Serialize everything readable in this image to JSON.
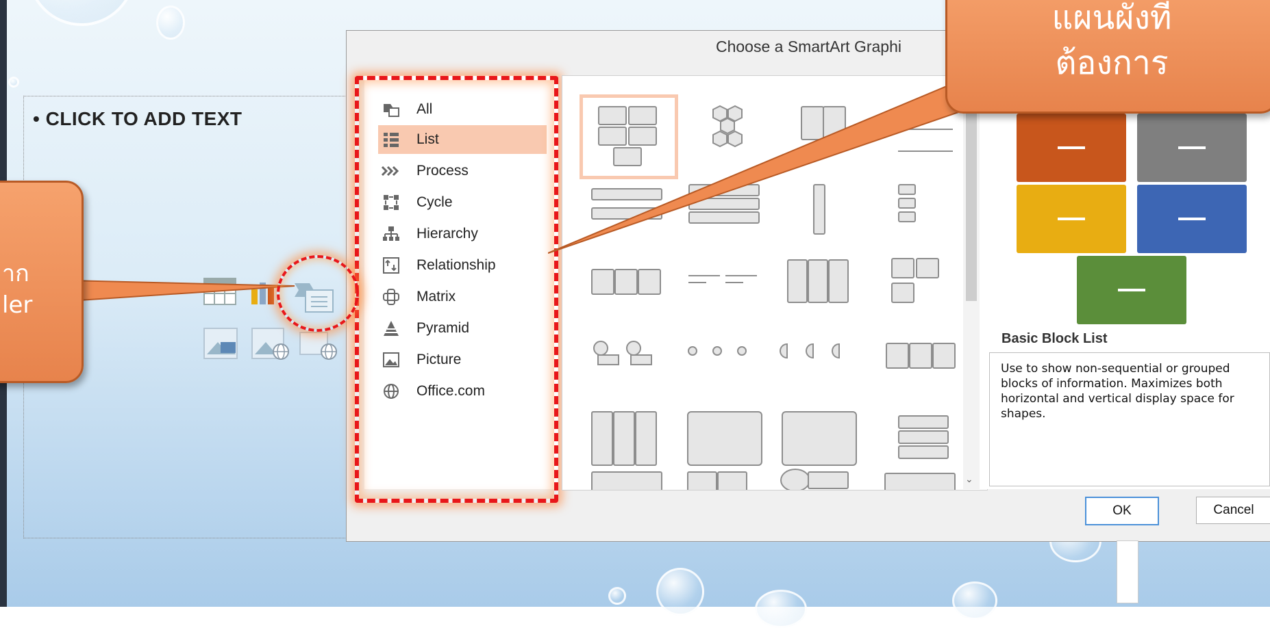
{
  "slide": {
    "bullet_text": "• CLICK TO ADD TEXT"
  },
  "dialog": {
    "title": "Choose a SmartArt Graphi",
    "categories": [
      {
        "label": "All",
        "icon": "all-icon"
      },
      {
        "label": "List",
        "icon": "list-icon",
        "selected": true
      },
      {
        "label": "Process",
        "icon": "process-icon"
      },
      {
        "label": "Cycle",
        "icon": "cycle-icon"
      },
      {
        "label": "Hierarchy",
        "icon": "hierarchy-icon"
      },
      {
        "label": "Relationship",
        "icon": "relationship-icon"
      },
      {
        "label": "Matrix",
        "icon": "matrix-icon"
      },
      {
        "label": "Pyramid",
        "icon": "pyramid-icon"
      },
      {
        "label": "Picture",
        "icon": "picture-icon"
      },
      {
        "label": "Office.com",
        "icon": "globe-icon"
      }
    ],
    "preview_colors": [
      "#c8561c",
      "#7f7f7f",
      "#e8ad12",
      "#3d66b4",
      "#5b8e3a"
    ],
    "selected_graphic_title": "Basic Block List",
    "selected_graphic_description": "Use to show non-sequential or grouped blocks of information. Maximizes both horizontal and vertical display space for shapes.",
    "ok_label": "OK",
    "cancel_label": "Cancel"
  },
  "callouts": {
    "top_right": [
      "แผนผังที่",
      "ต้องการ"
    ],
    "left": [
      "าก",
      "ler"
    ]
  },
  "colors": {
    "accent_orange": "#ef8a50",
    "dash_red": "#e8171a",
    "selection": "#f9c9b0"
  }
}
